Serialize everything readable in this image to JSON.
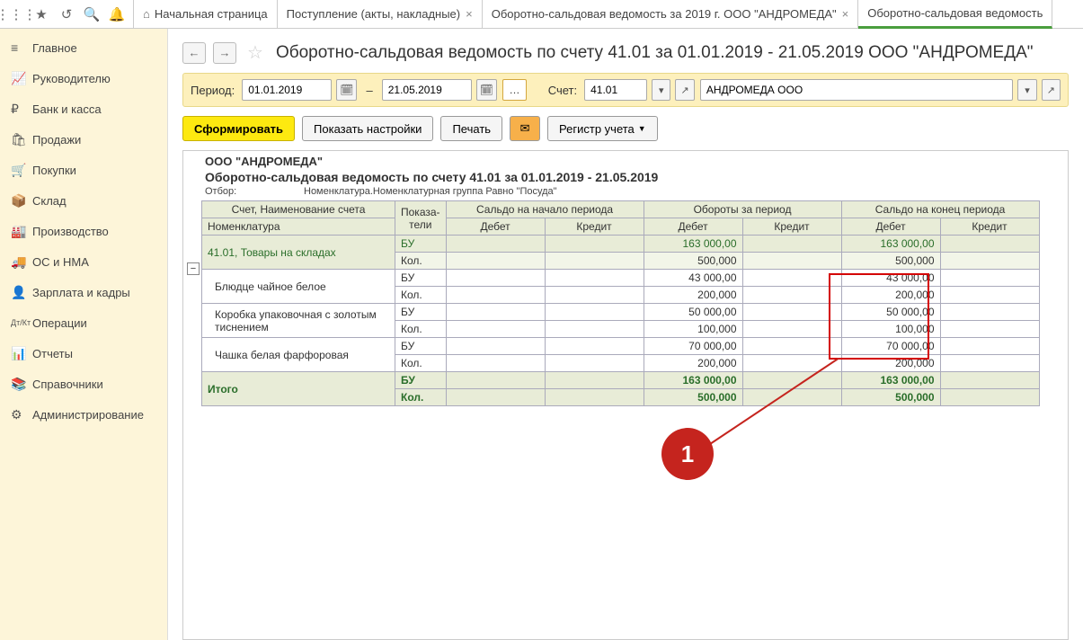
{
  "toolbar_icons": [
    "apps",
    "star",
    "history",
    "search",
    "bell"
  ],
  "tabs": [
    {
      "label": "Начальная страница",
      "home": true
    },
    {
      "label": "Поступление (акты, накладные)",
      "close": true
    },
    {
      "label": "Оборотно-сальдовая ведомость за 2019 г. ООО \"АНДРОМЕДА\"",
      "close": true
    },
    {
      "label": "Оборотно-сальдовая ведомость",
      "active": true
    }
  ],
  "sidebar": [
    {
      "icon": "≡",
      "label": "Главное"
    },
    {
      "icon": "📈",
      "label": "Руководителю"
    },
    {
      "icon": "₽",
      "label": "Банк и касса"
    },
    {
      "icon": "🛍",
      "label": "Продажи"
    },
    {
      "icon": "🛒",
      "label": "Покупки"
    },
    {
      "icon": "📦",
      "label": "Склад"
    },
    {
      "icon": "🏭",
      "label": "Производство"
    },
    {
      "icon": "🚚",
      "label": "ОС и НМА"
    },
    {
      "icon": "👤",
      "label": "Зарплата и кадры"
    },
    {
      "icon": "Дт/Кт",
      "label": "Операции"
    },
    {
      "icon": "📊",
      "label": "Отчеты"
    },
    {
      "icon": "📚",
      "label": "Справочники"
    },
    {
      "icon": "⚙",
      "label": "Администрирование"
    }
  ],
  "page_title": "Оборотно-сальдовая ведомость по счету 41.01 за 01.01.2019 - 21.05.2019 ООО \"АНДРОМЕДА\"",
  "period": {
    "label": "Период:",
    "from": "01.01.2019",
    "to": "21.05.2019"
  },
  "account": {
    "label": "Счет:",
    "value": "41.01"
  },
  "org_value": "АНДРОМЕДА ООО",
  "actions": {
    "form": "Сформировать",
    "settings": "Показать настройки",
    "print": "Печать",
    "register": "Регистр учета"
  },
  "report": {
    "org": "ООО \"АНДРОМЕДА\"",
    "title": "Оборотно-сальдовая ведомость по счету 41.01 за 01.01.2019 - 21.05.2019",
    "filter_label": "Отбор:",
    "filter_text": "Номенклатура.Номенклатурная группа Равно \"Посуда\"",
    "headers": {
      "acct": "Счет, Наименование счета",
      "nomen": "Номенклатура",
      "ind": "Показа-\nтели",
      "start": "Сальдо на начало периода",
      "turn": "Обороты за период",
      "end": "Сальдо на конец периода",
      "debit": "Дебет",
      "credit": "Кредит"
    },
    "group_row": {
      "name": "41.01, Товары на складах",
      "bu_debit_turn": "163 000,00",
      "bu_debit_end": "163 000,00",
      "kol_debit_turn": "500,000",
      "kol_debit_end": "500,000"
    },
    "items": [
      {
        "name": "Блюдце чайное белое",
        "bu_debit_turn": "43 000,00",
        "bu_debit_end": "43 000,00",
        "kol_debit_turn": "200,000",
        "kol_debit_end": "200,000"
      },
      {
        "name": "Коробка упаковочная с золотым тиснением",
        "bu_debit_turn": "50 000,00",
        "bu_debit_end": "50 000,00",
        "kol_debit_turn": "100,000",
        "kol_debit_end": "100,000"
      },
      {
        "name": "Чашка белая фарфоровая",
        "bu_debit_turn": "70 000,00",
        "bu_debit_end": "70 000,00",
        "kol_debit_turn": "200,000",
        "kol_debit_end": "200,000"
      }
    ],
    "total": {
      "label": "Итого",
      "bu_debit_turn": "163 000,00",
      "bu_debit_end": "163 000,00",
      "kol_debit_turn": "500,000",
      "kol_debit_end": "500,000"
    },
    "bu": "БУ",
    "kol": "Кол."
  },
  "callout": "1"
}
